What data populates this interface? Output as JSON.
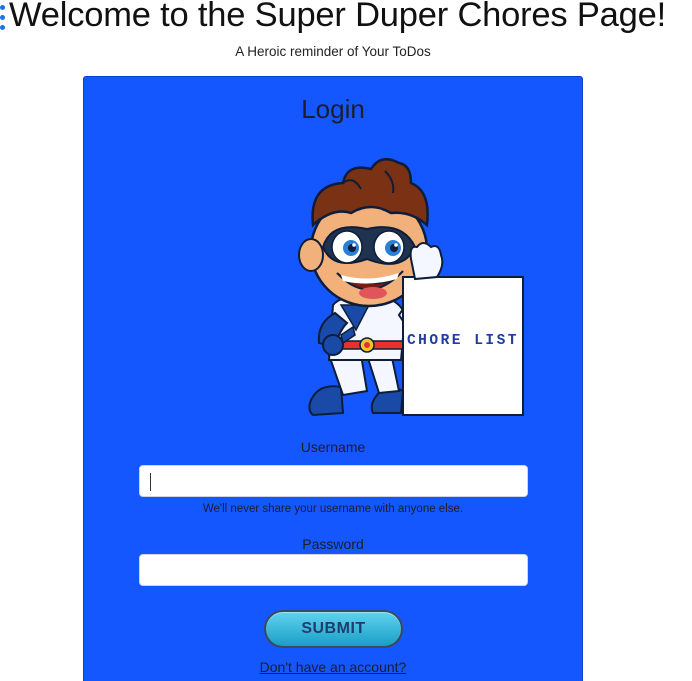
{
  "header": {
    "title": "Welcome to the Super Duper Chores Page!",
    "subtitle": "A Heroic reminder of Your ToDos"
  },
  "login_card": {
    "title": "Login",
    "hero_sign_text": "CHORE LIST",
    "username_label": "Username",
    "username_value": "",
    "username_help": "We'll never share your username with anyone else.",
    "password_label": "Password",
    "password_value": "",
    "submit_label": "SUBMIT",
    "signup_link": "Don't have an account?"
  },
  "colors": {
    "card_background": "#1557ff",
    "submit_button": "#2bb5dc",
    "menu_dots": "#1a73e8"
  },
  "icons": {
    "menu": "menu-dots-icon",
    "hero": "superhero-mascot-illustration"
  }
}
